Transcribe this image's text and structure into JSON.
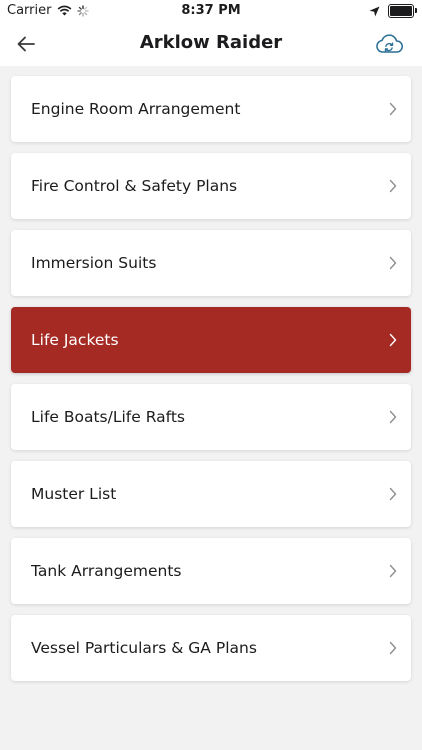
{
  "status_bar": {
    "carrier": "Carrier",
    "time": "8:37 PM",
    "icons": [
      "wifi-icon",
      "spinner-icon",
      "location-arrow-icon",
      "battery-icon"
    ]
  },
  "nav": {
    "title": "Arklow Raider",
    "back_icon": "arrow-left-icon",
    "sync_icon": "cloud-sync-icon"
  },
  "colors": {
    "accent": "#a52a24",
    "icon_blue": "#2b6e96",
    "background": "#f2f2f2"
  },
  "items": [
    {
      "label": "Engine Room Arrangement",
      "active": false
    },
    {
      "label": "Fire Control & Safety Plans",
      "active": false
    },
    {
      "label": "Immersion Suits",
      "active": false
    },
    {
      "label": "Life Jackets",
      "active": true
    },
    {
      "label": "Life Boats/Life Rafts",
      "active": false
    },
    {
      "label": "Muster List",
      "active": false
    },
    {
      "label": "Tank Arrangements",
      "active": false
    },
    {
      "label": "Vessel Particulars & GA Plans",
      "active": false
    }
  ]
}
